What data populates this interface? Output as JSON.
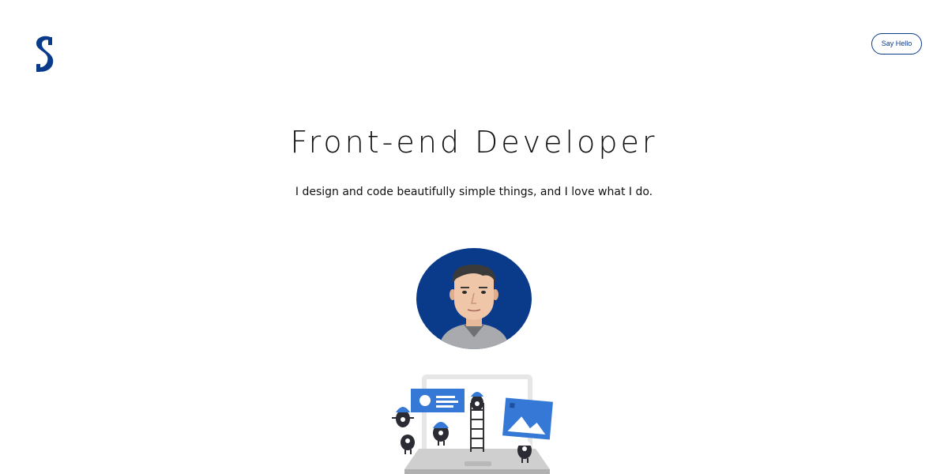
{
  "header": {
    "logo": {
      "icon": "s-monogram-logo",
      "color": "#0a3a8a"
    },
    "cta_label": "Say Hello"
  },
  "hero": {
    "title": "Front-end Developer",
    "subtitle": "I design and code beautifully simple things, and I love what I do."
  },
  "avatar": {
    "icon": "developer-portrait-avatar",
    "background_color": "#0a3a8a"
  },
  "illustration": {
    "icon": "laptop-monsters-illustration",
    "accent_color": "#3578d6"
  },
  "colors": {
    "brand": "#0a3a8a",
    "accent": "#3578d6",
    "text": "#111111",
    "background": "#ffffff"
  }
}
